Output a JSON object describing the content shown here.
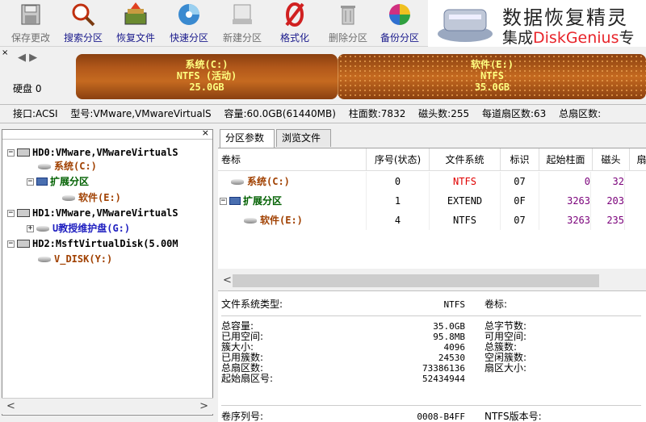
{
  "toolbar": {
    "buttons": [
      {
        "label": "保存更改",
        "icon": "save-changes-icon"
      },
      {
        "label": "搜索分区",
        "icon": "search-partition-icon"
      },
      {
        "label": "恢复文件",
        "icon": "recover-files-icon"
      },
      {
        "label": "快速分区",
        "icon": "quick-partition-icon"
      },
      {
        "label": "新建分区",
        "icon": "new-partition-icon"
      },
      {
        "label": "格式化",
        "icon": "format-icon"
      },
      {
        "label": "删除分区",
        "icon": "delete-partition-icon"
      },
      {
        "label": "备份分区",
        "icon": "backup-partition-icon"
      }
    ]
  },
  "banner": {
    "title": "数据恢复精灵",
    "subtitle_prefix": "集成",
    "subtitle_brand": "DiskGenius",
    "subtitle_suffix": "专"
  },
  "disk_bar": {
    "close": "×",
    "nav": "◀ ▶",
    "disk_label": "硬盘 0",
    "partitions": [
      {
        "name": "系统(C:)",
        "fs": "NTFS (活动)",
        "size": "25.0GB"
      },
      {
        "name": "软件(E:)",
        "fs": "NTFS",
        "size": "35.0GB"
      }
    ]
  },
  "info_bar": {
    "interface": "接口:ACSI",
    "model": "型号:VMware,VMwareVirtualS",
    "capacity": "容量:60.0GB(61440MB)",
    "cylinders": "柱面数:7832",
    "heads": "磁头数:255",
    "sectors_per_track": "每道扇区数:63",
    "total_sectors": "总扇区数:"
  },
  "tree": {
    "close": "×",
    "nodes": [
      {
        "label": "HD0:VMware,VMwareVirtualS",
        "expander": "−"
      },
      {
        "label": "系统(C:)"
      },
      {
        "label": "扩展分区",
        "expander": "−"
      },
      {
        "label": "软件(E:)"
      },
      {
        "label": "HD1:VMware,VMwareVirtualS",
        "expander": "−"
      },
      {
        "label": "U教授维护盘(G:)",
        "expander": "+"
      },
      {
        "label": "HD2:MsftVirtualDisk(5.00M",
        "expander": "−"
      },
      {
        "label": "V_DISK(Y:)"
      }
    ],
    "scroll_left": "<",
    "scroll_right": ">"
  },
  "tabs": [
    {
      "label": "分区参数"
    },
    {
      "label": "浏览文件"
    }
  ],
  "partition_table": {
    "headers": [
      "卷标",
      "序号(状态)",
      "文件系统",
      "标识",
      "起始柱面",
      "磁头",
      "扇"
    ],
    "rows": [
      {
        "label": "系统(C:)",
        "index": "0",
        "fs": "NTFS",
        "id": "07",
        "start_cyl": "0",
        "head": "32"
      },
      {
        "label": "扩展分区",
        "expander": "−",
        "index": "1",
        "fs": "EXTEND",
        "id": "0F",
        "start_cyl": "3263",
        "head": "203"
      },
      {
        "label": "软件(E:)",
        "index": "4",
        "fs": "NTFS",
        "id": "07",
        "start_cyl": "3263",
        "head": "235"
      }
    ]
  },
  "scrollbar": {
    "left": "<"
  },
  "details": {
    "fs_type_label": "文件系统类型:",
    "fs_type_value": "NTFS",
    "volume_label_label": "卷标:",
    "left_labels": [
      "总容量:",
      "已用空间:",
      "簇大小:",
      "已用簇数:",
      "总扇区数:",
      "起始扇区号:"
    ],
    "left_values": [
      "35.0GB",
      "95.8MB",
      "4096",
      "24530",
      "73386136",
      "52434944"
    ],
    "right_labels": [
      "总字节数:",
      "可用空间:",
      "总簇数:",
      "空闲簇数:",
      "扇区大小:"
    ],
    "serial_label": "卷序列号:",
    "serial_value": "0008-B4FF",
    "ntfs_version_label": "NTFS版本号:"
  },
  "colors": {
    "partition_fill": "#b2581a",
    "partition_text": "#ffff80",
    "link_blue": "#1a1a8c",
    "ntfs_red": "#e00000",
    "purple": "#7a007a",
    "brand_red": "#e8242a"
  }
}
